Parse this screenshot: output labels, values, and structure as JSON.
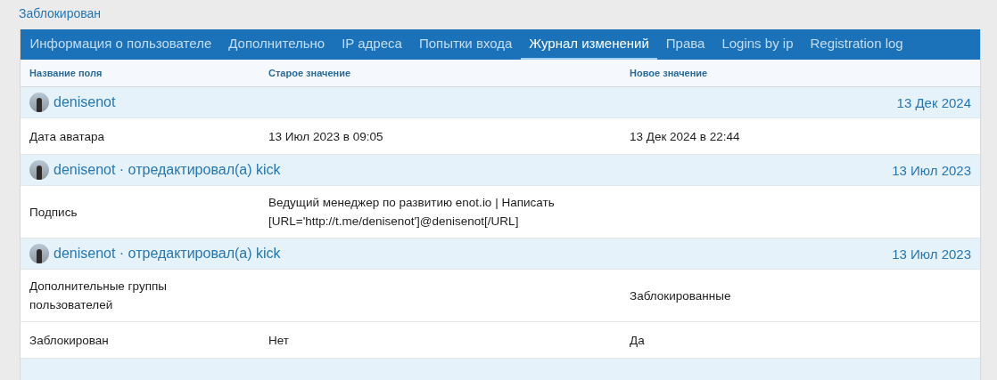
{
  "status_link": "Заблокирован",
  "tabs": [
    {
      "label": "Информация о пользователе",
      "selected": false
    },
    {
      "label": "Дополнительно",
      "selected": false
    },
    {
      "label": "IP адреса",
      "selected": false
    },
    {
      "label": "Попытки входа",
      "selected": false
    },
    {
      "label": "Журнал изменений",
      "selected": true
    },
    {
      "label": "Права",
      "selected": false
    },
    {
      "label": "Logins by ip",
      "selected": false
    },
    {
      "label": "Registration log",
      "selected": false
    }
  ],
  "columns": [
    "Название поля",
    "Старое значение",
    "Новое значение"
  ],
  "groups": [
    {
      "title": "denisenot",
      "date": "13 Дек 2024",
      "rows": [
        {
          "field": "Дата аватара",
          "old": "13 Июл 2023 в 09:05",
          "new": "13 Дек 2024 в 22:44"
        }
      ]
    },
    {
      "title": "denisenot · отредактировал(а) kick",
      "date": "13 Июл 2023",
      "rows": [
        {
          "field": "Подпись",
          "old": "Ведущий менеджер по развитию enot.io | Написать [URL='http://t.me/denisenot']@denisenot[/URL]",
          "new": ""
        }
      ]
    },
    {
      "title": "denisenot · отредактировал(а) kick",
      "date": "13 Июл 2023",
      "rows": [
        {
          "field": "Дополнительные группы пользователей",
          "old": "",
          "new": "Заблокированные"
        },
        {
          "field": "Заблокирован",
          "old": "Нет",
          "new": "Да"
        }
      ]
    }
  ]
}
